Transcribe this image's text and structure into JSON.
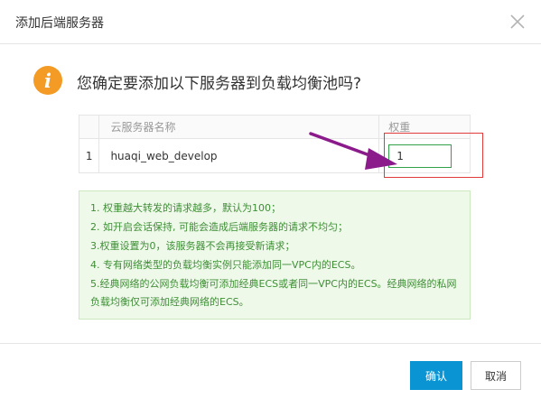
{
  "dialog": {
    "title": "添加后端服务器",
    "close_icon": "close-icon",
    "question": "您确定要添加以下服务器到负载均衡池吗?",
    "question_icon": "info-icon",
    "info_icon_glyph": "i",
    "table": {
      "columns": [
        "",
        "云服务器名称",
        "权重"
      ],
      "rows": [
        {
          "index": "1",
          "name": "huaqi_web_develop",
          "weight": "1"
        }
      ]
    },
    "notes": [
      "1. 权重越大转发的请求越多，默认为100；",
      "2. 如开启会话保持, 可能会造成后端服务器的请求不均匀；",
      "3.权重设置为0，该服务器不会再接受新请求；",
      "4. 专有网络类型的负载均衡实例只能添加同一VPC内的ECS。",
      "5.经典网络的公网负载均衡可添加经典ECS或者同一VPC内的ECS。经典网络的私网负载均衡仅可添加经典网络的ECS。"
    ],
    "buttons": {
      "ok": "确认",
      "cancel": "取消"
    },
    "colors": {
      "accent": "#0b94d3",
      "info_icon": "#f39b24",
      "note_bg": "#eef9ea",
      "note_text": "#3f8e35",
      "annotation_arrow": "#8b1a8b",
      "annotation_box": "#e03c3c"
    }
  }
}
